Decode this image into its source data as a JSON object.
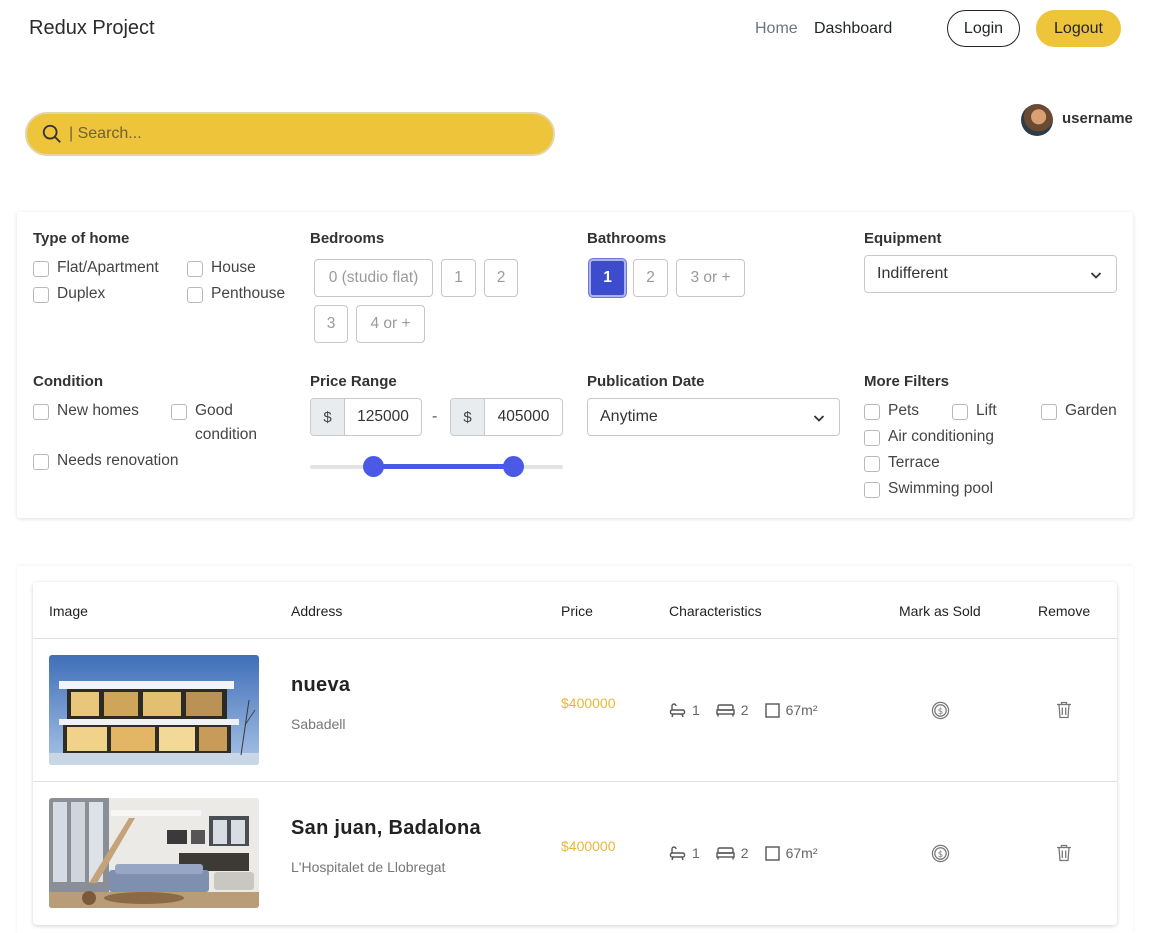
{
  "navbar": {
    "brand": "Redux Project",
    "links": {
      "home": "Home",
      "dashboard": "Dashboard"
    },
    "login_label": "Login",
    "logout_label": "Logout"
  },
  "search": {
    "placeholder": "| Search...",
    "value": ""
  },
  "user": {
    "name": "username",
    "avatar_icon": "user-avatar"
  },
  "filters": {
    "type_of_home": {
      "title": "Type of home",
      "options": [
        "Flat/Apartment",
        "House",
        "Duplex",
        "Penthouse"
      ]
    },
    "bedrooms": {
      "title": "Bedrooms",
      "options": [
        "0 (studio flat)",
        "1",
        "2",
        "3",
        "4 or +"
      ]
    },
    "bathrooms": {
      "title": "Bathrooms",
      "options": [
        "1",
        "2",
        "3 or +"
      ],
      "selected": "1"
    },
    "equipment": {
      "title": "Equipment",
      "selected": "Indifferent"
    },
    "condition": {
      "title": "Condition",
      "options": [
        "New homes",
        "Good condition",
        "Needs renovation"
      ]
    },
    "price_range": {
      "title": "Price Range",
      "currency": "$",
      "min": "125000",
      "max": "405000",
      "separator": "-"
    },
    "publication_date": {
      "title": "Publication Date",
      "selected": "Anytime"
    },
    "more_filters": {
      "title": "More Filters",
      "options": [
        "Pets",
        "Lift",
        "Garden",
        "Air conditioning",
        "Terrace",
        "Swimming pool"
      ]
    }
  },
  "table": {
    "headers": [
      "Image",
      "Address",
      "Price",
      "Characteristics",
      "Mark as Sold",
      "Remove"
    ],
    "rows": [
      {
        "title": "nueva",
        "city": "Sabadell",
        "price": "$400000",
        "bathrooms": "1",
        "bedrooms": "2",
        "area": "67m²"
      },
      {
        "title": "San juan, Badalona",
        "city": "L'Hospitalet de Llobregat",
        "price": "$400000",
        "bathrooms": "1",
        "bedrooms": "2",
        "area": "67m²"
      }
    ]
  },
  "colors": {
    "accent_yellow": "#eec43a",
    "primary_blue": "#4a59e6",
    "price_color": "#e8b73a"
  }
}
